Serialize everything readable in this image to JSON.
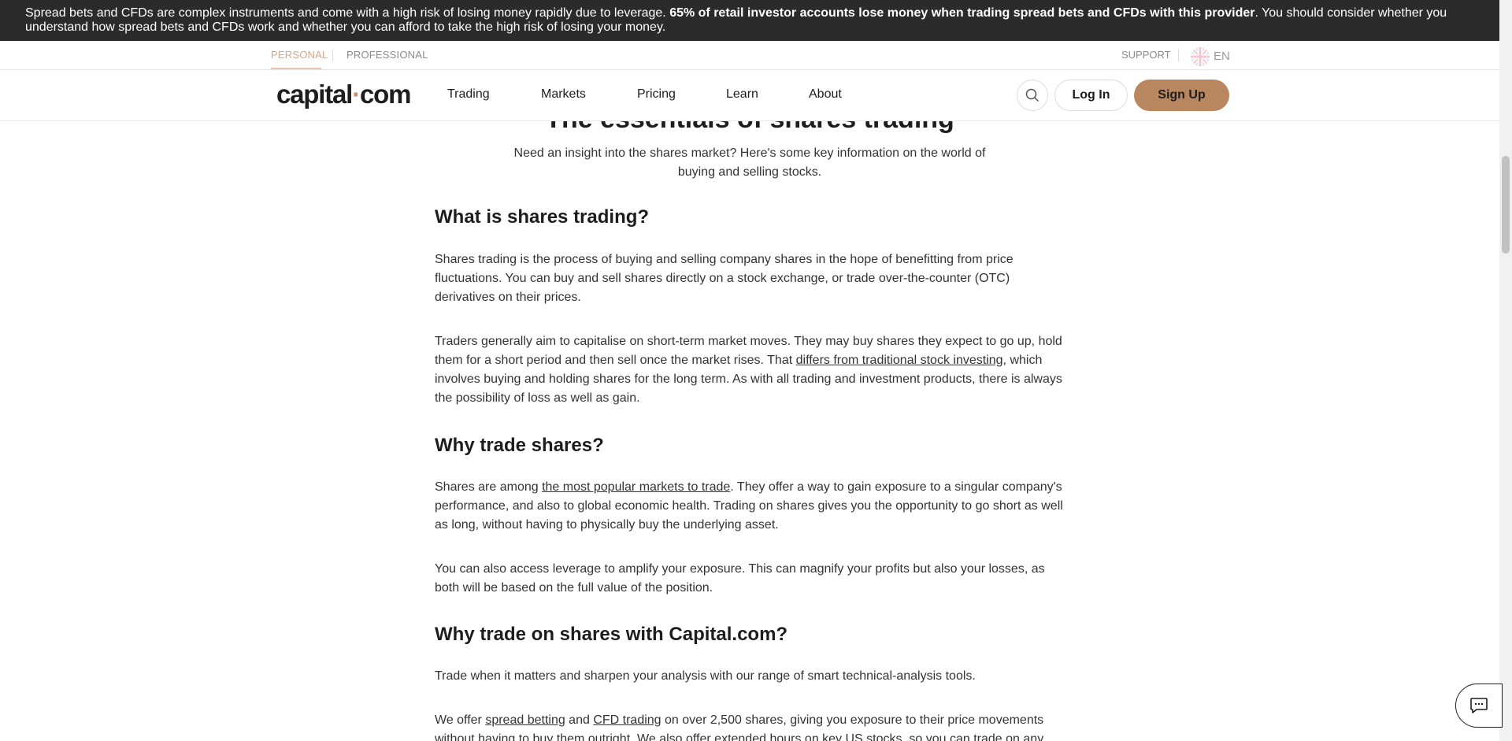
{
  "risk_warning": {
    "text_before": "Spread bets and CFDs are complex instruments and come with a high risk of losing money rapidly due to leverage. ",
    "bold": "65% of retail investor accounts lose money when trading spread bets and CFDs with this provider",
    "text_after": ". You should consider whether you understand how spread bets and CFDs work and whether you can afford to take the high risk of losing your money."
  },
  "top_bar": {
    "personal": "PERSONAL",
    "professional": "PROFESSIONAL",
    "support": "SUPPORT",
    "language": "EN"
  },
  "nav": {
    "logo_left": "capital",
    "logo_dot": "·",
    "logo_right": "com",
    "items": [
      "Trading",
      "Markets",
      "Pricing",
      "Learn",
      "About"
    ],
    "login": "Log In",
    "signup": "Sign Up"
  },
  "article": {
    "title": "The essentials of shares trading",
    "intro": "Need an insight into the shares market? Here's some key information on the world of buying and selling stocks.",
    "s1_heading": "What is shares trading?",
    "s1_p1": "Shares trading is the process of buying and selling company shares in the hope of benefitting from price fluctuations. You can buy and sell shares directly on a stock exchange, or trade over-the-counter (OTC) derivatives on their prices.",
    "s1_p2_before": "Traders generally aim to capitalise on short-term market moves. They may buy shares they expect to go up, hold them for a short period and then sell once the market rises. That ",
    "s1_p2_link": "differs from traditional stock investing",
    "s1_p2_after": ", which involves buying and holding shares for the long term. As with all trading and investment products, there is always the possibility of loss as well as gain.",
    "s2_heading": "Why trade shares?",
    "s2_p1_before": "Shares are among ",
    "s2_p1_link": "the most popular markets to trade",
    "s2_p1_after": ". They offer a way to gain exposure to a singular company's performance, and also to global economic health. Trading on shares gives you the opportunity to go short as well as long, without having to physically buy the underlying asset.",
    "s2_p2": "You can also access leverage to amplify your exposure. This can magnify your profits but also your losses, as both will be based on the full value of the position.",
    "s3_heading": "Why trade on shares with Capital.com?",
    "s3_p1": "Trade when it matters and sharpen your analysis with our range of smart technical-analysis tools.",
    "s3_p2_before": "We offer ",
    "s3_p2_link1": "spread betting",
    "s3_p2_mid": " and ",
    "s3_p2_link2": "CFD trading",
    "s3_p2_after": " on over 2,500 shares, giving you exposure to their price movements without having to buy them outright. We also offer extended hours on key US stocks, so you can trade on any"
  },
  "colors": {
    "banner_bg": "#2b2b2b",
    "accent": "#b8875f",
    "personal_active": "#d6a78a"
  },
  "icons": {
    "search": "search-icon",
    "flag": "uk-flag-icon",
    "chat": "chat-icon"
  }
}
